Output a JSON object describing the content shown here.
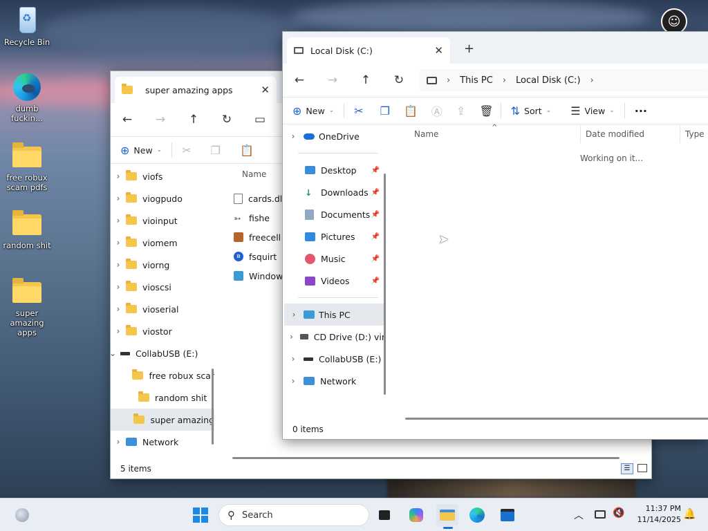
{
  "desktop": {
    "icons": [
      {
        "label": "Recycle Bin"
      },
      {
        "label": "dumb fuckin..."
      },
      {
        "label": "free robux scam pdfs"
      },
      {
        "label": "random shit"
      },
      {
        "label": "super amazing apps"
      }
    ]
  },
  "back_window": {
    "tab_title": "super amazing apps",
    "new_label": "New",
    "tree": [
      {
        "label": "viofs"
      },
      {
        "label": "viogpudo"
      },
      {
        "label": "vioinput"
      },
      {
        "label": "viomem"
      },
      {
        "label": "viorng"
      },
      {
        "label": "vioscsi"
      },
      {
        "label": "vioserial"
      },
      {
        "label": "viostor"
      },
      {
        "label": "CollabUSB (E:)"
      },
      {
        "label": "free robux scar"
      },
      {
        "label": "random shit"
      },
      {
        "label": "super amazing"
      },
      {
        "label": "Network"
      }
    ],
    "column_name": "Name",
    "files": [
      {
        "label": "cards.dll"
      },
      {
        "label": "fishe"
      },
      {
        "label": "freecell"
      },
      {
        "label": "fsquirt"
      },
      {
        "label": "Windows"
      }
    ],
    "status": "5 items"
  },
  "front_window": {
    "tab_title": "Local Disk (C:)",
    "breadcrumb": [
      "This PC",
      "Local Disk (C:)"
    ],
    "commands": {
      "new": "New",
      "sort": "Sort",
      "view": "View"
    },
    "nav": {
      "onedrive": "OneDrive",
      "quick": [
        {
          "label": "Desktop"
        },
        {
          "label": "Downloads"
        },
        {
          "label": "Documents"
        },
        {
          "label": "Pictures"
        },
        {
          "label": "Music"
        },
        {
          "label": "Videos"
        }
      ],
      "drives": [
        {
          "label": "This PC"
        },
        {
          "label": "CD Drive (D:) vir"
        },
        {
          "label": "CollabUSB (E:)"
        },
        {
          "label": "Network"
        }
      ]
    },
    "columns": {
      "name": "Name",
      "date": "Date modified",
      "type": "Type"
    },
    "working": "Working on it...",
    "status": "0 items"
  },
  "taskbar": {
    "search_placeholder": "Search",
    "time": "11:37 PM",
    "date": "11/14/2025"
  }
}
